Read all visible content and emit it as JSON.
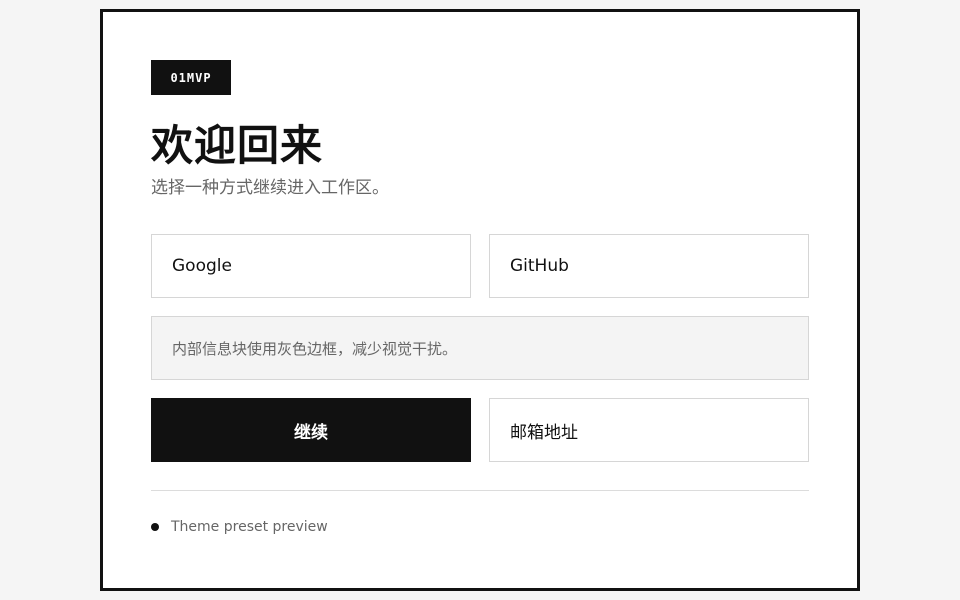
{
  "brand": {
    "badge": "01MVP"
  },
  "header": {
    "title": "欢迎回来",
    "subtitle": "选择一种方式继续进入工作区。"
  },
  "auth": {
    "google_label": "Google",
    "github_label": "GitHub",
    "info_text": "内部信息块使用灰色边框，减少视觉干扰。",
    "continue_label": "继续",
    "email_label": "邮箱地址"
  },
  "footer": {
    "text": "Theme preset preview",
    "dot_icon": "status-dot-icon"
  },
  "colors": {
    "background": "#f5f5f5",
    "card": "#ffffff",
    "primary": "#111111",
    "muted_text": "#666666",
    "border": "#d6d6d6",
    "info_bg": "#f4f4f4"
  }
}
